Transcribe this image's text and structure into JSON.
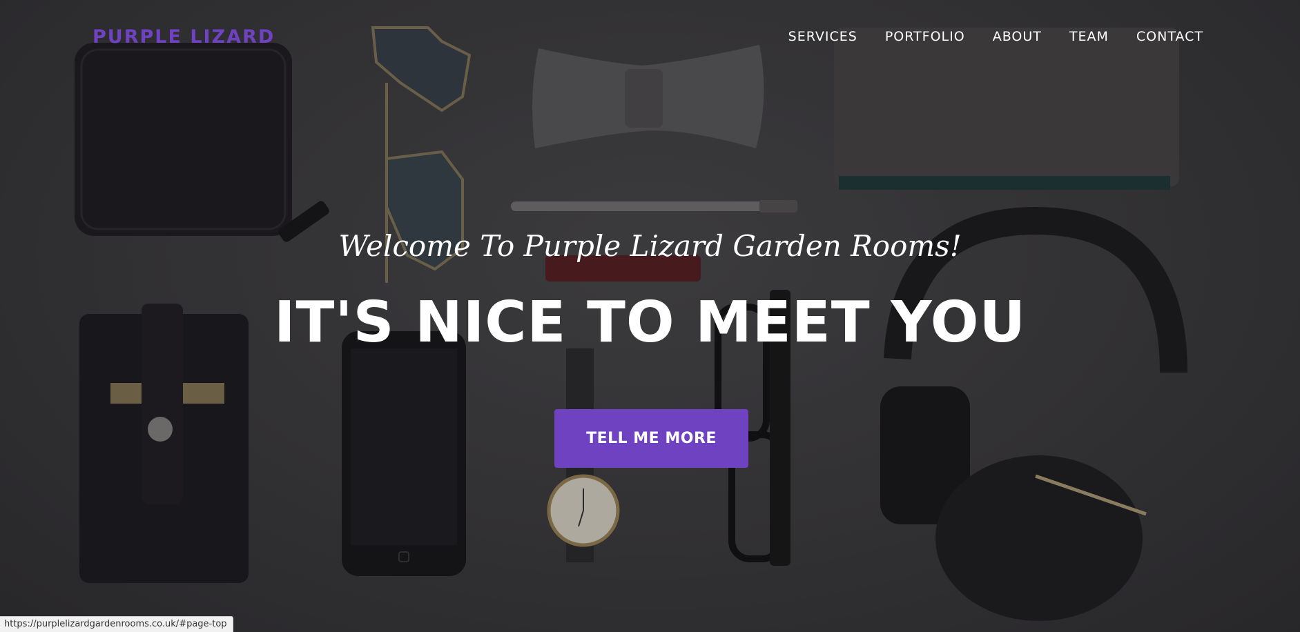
{
  "brand": {
    "name": "PURPLE LIZARD"
  },
  "nav": {
    "items": [
      "SERVICES",
      "PORTFOLIO",
      "ABOUT",
      "TEAM",
      "CONTACT"
    ]
  },
  "hero": {
    "subheading": "Welcome To Purple Lizard Garden Rooms!",
    "heading": "IT'S NICE TO MEET YOU",
    "cta_label": "TELL ME MORE"
  },
  "status_bar": {
    "url": "https://purplelizardgardenrooms.co.uk/#page-top"
  },
  "colors": {
    "accent": "#6f42c1",
    "text": "#ffffff",
    "background": "#3b3a3c"
  }
}
